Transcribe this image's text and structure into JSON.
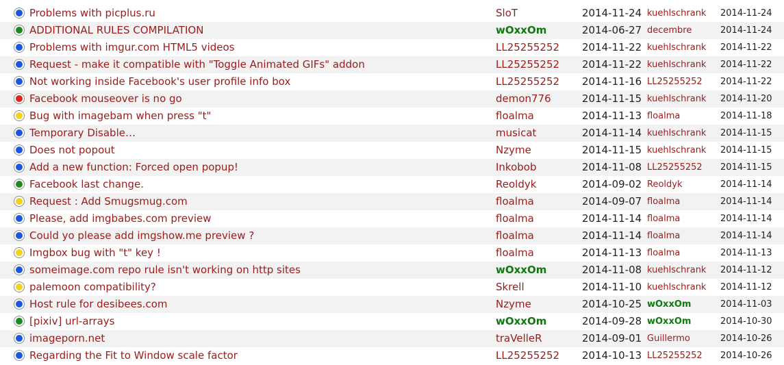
{
  "colors": {
    "link": "#9b1b1b",
    "moderator": "#0f7a0f",
    "row_alt": "#f2f2f2",
    "dot_blue": "#1a56e0",
    "dot_green": "#1d8a1d",
    "dot_red": "#e0231b",
    "dot_yellow": "#f3d21d"
  },
  "rows": [
    {
      "status": "blue",
      "title": "Problems with picplus.ru",
      "author": "SloT",
      "author_mod": false,
      "date": "2014-11-24",
      "last_poster": "kuehlschrank",
      "last_mod": false,
      "last_date": "2014-11-24"
    },
    {
      "status": "green",
      "title": "ADDITIONAL RULES COMPILATION",
      "author": "wOxxOm",
      "author_mod": true,
      "date": "2014-06-27",
      "last_poster": "decembre",
      "last_mod": false,
      "last_date": "2014-11-24"
    },
    {
      "status": "blue",
      "title": "Problems with imgur.com HTML5 videos",
      "author": "LL25255252",
      "author_mod": false,
      "date": "2014-11-22",
      "last_poster": "kuehlschrank",
      "last_mod": false,
      "last_date": "2014-11-22"
    },
    {
      "status": "blue",
      "title": "Request - make it compatible with \"Toggle Animated GIFs\" addon",
      "author": "LL25255252",
      "author_mod": false,
      "date": "2014-11-22",
      "last_poster": "kuehlschrank",
      "last_mod": false,
      "last_date": "2014-11-22"
    },
    {
      "status": "blue",
      "title": "Not working inside Facebook's user profile info box",
      "author": "LL25255252",
      "author_mod": false,
      "date": "2014-11-16",
      "last_poster": "LL25255252",
      "last_mod": false,
      "last_date": "2014-11-22"
    },
    {
      "status": "red",
      "title": "Facebook mouseover is no go",
      "author": "demon776",
      "author_mod": false,
      "date": "2014-11-15",
      "last_poster": "kuehlschrank",
      "last_mod": false,
      "last_date": "2014-11-20"
    },
    {
      "status": "yellow",
      "title": "Bug with imagebam when press \"t\"",
      "author": "floalma",
      "author_mod": false,
      "date": "2014-11-13",
      "last_poster": "floalma",
      "last_mod": false,
      "last_date": "2014-11-18"
    },
    {
      "status": "blue",
      "title": "Temporary Disable…",
      "author": "musicat",
      "author_mod": false,
      "date": "2014-11-14",
      "last_poster": "kuehlschrank",
      "last_mod": false,
      "last_date": "2014-11-15"
    },
    {
      "status": "blue",
      "title": "Does not popout",
      "author": "Nzyme",
      "author_mod": false,
      "date": "2014-11-15",
      "last_poster": "kuehlschrank",
      "last_mod": false,
      "last_date": "2014-11-15"
    },
    {
      "status": "blue",
      "title": "Add a new function: Forced open popup!",
      "author": "Inkobob",
      "author_mod": false,
      "date": "2014-11-08",
      "last_poster": "LL25255252",
      "last_mod": false,
      "last_date": "2014-11-15"
    },
    {
      "status": "green",
      "title": "Facebook last change.",
      "author": "Reoldyk",
      "author_mod": false,
      "date": "2014-09-02",
      "last_poster": "Reoldyk",
      "last_mod": false,
      "last_date": "2014-11-14"
    },
    {
      "status": "yellow",
      "title": "Request : Add Smugsmug.com",
      "author": "floalma",
      "author_mod": false,
      "date": "2014-09-07",
      "last_poster": "floalma",
      "last_mod": false,
      "last_date": "2014-11-14"
    },
    {
      "status": "blue",
      "title": "Please, add imgbabes.com preview",
      "author": "floalma",
      "author_mod": false,
      "date": "2014-11-14",
      "last_poster": "floalma",
      "last_mod": false,
      "last_date": "2014-11-14"
    },
    {
      "status": "blue",
      "title": "Could yo please add imgshow.me preview ?",
      "author": "floalma",
      "author_mod": false,
      "date": "2014-11-14",
      "last_poster": "floalma",
      "last_mod": false,
      "last_date": "2014-11-14"
    },
    {
      "status": "yellow",
      "title": "Imgbox bug with \"t\" key !",
      "author": "floalma",
      "author_mod": false,
      "date": "2014-11-13",
      "last_poster": "floalma",
      "last_mod": false,
      "last_date": "2014-11-13"
    },
    {
      "status": "blue",
      "title": "someimage.com repo rule isn't working on http sites",
      "author": "wOxxOm",
      "author_mod": true,
      "date": "2014-11-08",
      "last_poster": "kuehlschrank",
      "last_mod": false,
      "last_date": "2014-11-12"
    },
    {
      "status": "yellow",
      "title": "palemoon compatibility?",
      "author": "Skrell",
      "author_mod": false,
      "date": "2014-11-10",
      "last_poster": "kuehlschrank",
      "last_mod": false,
      "last_date": "2014-11-12"
    },
    {
      "status": "blue",
      "title": "Host rule for desibees.com",
      "author": "Nzyme",
      "author_mod": false,
      "date": "2014-10-25",
      "last_poster": "wOxxOm",
      "last_mod": true,
      "last_date": "2014-11-03"
    },
    {
      "status": "green",
      "title": "[pixiv] url-arrays",
      "author": "wOxxOm",
      "author_mod": true,
      "date": "2014-09-28",
      "last_poster": "wOxxOm",
      "last_mod": true,
      "last_date": "2014-10-30"
    },
    {
      "status": "blue",
      "title": "imageporn.net",
      "author": "traVelleR",
      "author_mod": false,
      "date": "2014-09-01",
      "last_poster": "Guillermo",
      "last_mod": false,
      "last_date": "2014-10-26"
    },
    {
      "status": "blue",
      "title": "Regarding the Fit to Window scale factor",
      "author": "LL25255252",
      "author_mod": false,
      "date": "2014-10-13",
      "last_poster": "LL25255252",
      "last_mod": false,
      "last_date": "2014-10-26"
    }
  ]
}
